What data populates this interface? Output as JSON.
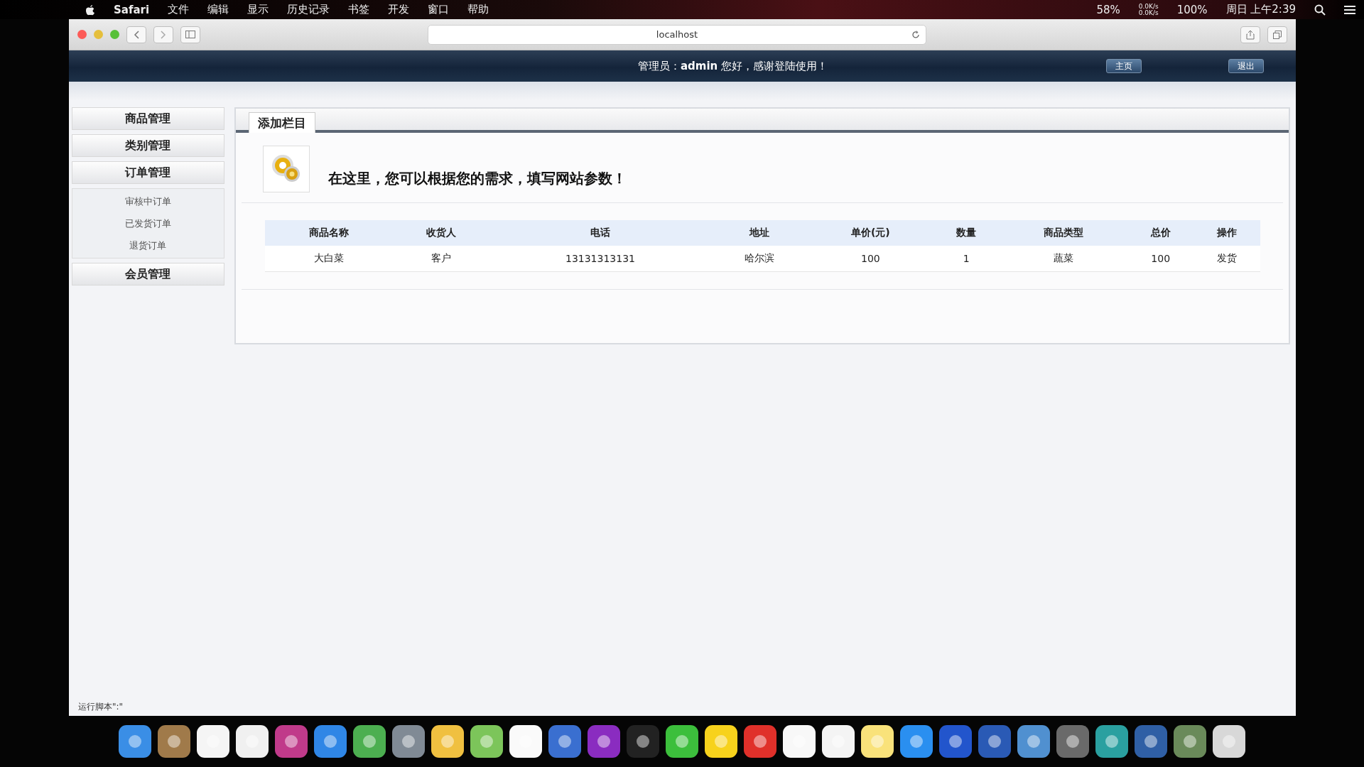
{
  "menu_bar": {
    "app": "Safari",
    "items": [
      "文件",
      "编辑",
      "显示",
      "历史记录",
      "书签",
      "开发",
      "窗口",
      "帮助"
    ],
    "status": [
      {
        "kind": "text",
        "text": "58%"
      },
      {
        "kind": "net",
        "up": "0.0K/s",
        "down": "0.0K/s"
      },
      {
        "kind": "text",
        "text": "100%"
      },
      {
        "kind": "clock",
        "text": "周日 上午2:39"
      }
    ]
  },
  "browser": {
    "address": "localhost"
  },
  "header": {
    "prefix": "管理员：",
    "user": "admin",
    "greeting": " 您好，感谢登陆使用！",
    "buttons": [
      "主页",
      "退出"
    ]
  },
  "sidebar": {
    "groups": [
      {
        "label": "商品管理"
      },
      {
        "label": "类别管理"
      },
      {
        "label": "订单管理",
        "children": [
          {
            "label": "审核中订单"
          },
          {
            "label": "已发货订单"
          },
          {
            "label": "退货订单"
          }
        ]
      },
      {
        "label": "会员管理"
      }
    ]
  },
  "panel": {
    "tab": "添加栏目",
    "heading": "在这里，您可以根据您的需求，填写网站参数！",
    "table": {
      "columns": [
        "商品名称",
        "收货人",
        "电话",
        "地址",
        "单价(元)",
        "数量",
        "商品类型",
        "总价",
        "操作"
      ],
      "rows": [
        {
          "cells": [
            "大白菜",
            "客户",
            "13131313131",
            "哈尔滨",
            "100",
            "1",
            "蔬菜",
            "100"
          ],
          "action": "发货"
        }
      ]
    }
  },
  "status_bar": {
    "text": "运行脚本\":\""
  }
}
